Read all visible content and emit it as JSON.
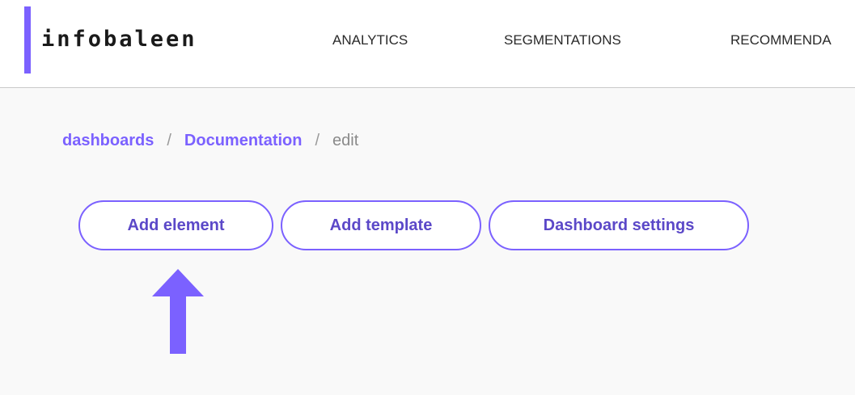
{
  "brand": {
    "name": "infobaleen",
    "accent_color": "#7b61ff"
  },
  "nav": {
    "items": [
      {
        "label": "ANALYTICS"
      },
      {
        "label": "SEGMENTATIONS"
      },
      {
        "label": "RECOMMENDA"
      }
    ]
  },
  "breadcrumb": {
    "items": [
      {
        "label": "dashboards"
      },
      {
        "label": "Documentation"
      },
      {
        "label": "edit"
      }
    ],
    "separator": "/"
  },
  "actions": {
    "add_element": "Add element",
    "add_template": "Add template",
    "dashboard_settings": "Dashboard settings"
  },
  "annotation": {
    "icon": "up-arrow-icon",
    "color": "#7b61ff"
  }
}
